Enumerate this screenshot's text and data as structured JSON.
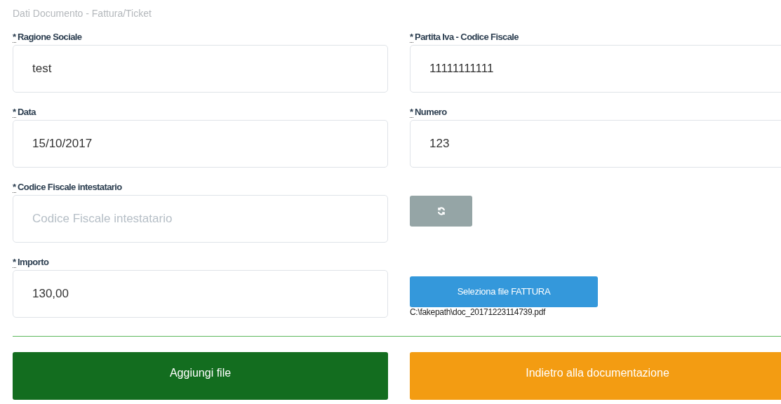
{
  "section_title": "Dati Documento - Fattura/Ticket",
  "fields": [
    {
      "label": "Ragione Sociale",
      "required_mark": "*",
      "value": "test"
    },
    {
      "label": "Partita Iva - Codice Fiscale",
      "required_mark": "*",
      "value": "11111111111"
    },
    {
      "label": "Data",
      "required_mark": "*",
      "value": "15/10/2017"
    },
    {
      "label": "Numero",
      "required_mark": "*",
      "value": "123"
    },
    {
      "label": "Codice Fiscale intestatario",
      "required_mark": "*",
      "placeholder": "Codice Fiscale intestatario"
    },
    {
      "kind": "refresh"
    },
    {
      "label": "Importo",
      "required_mark": "*",
      "value": "130,00"
    },
    {
      "kind": "file",
      "button": "Seleziona file FATTURA",
      "file_name": "C:\\fakepath\\doc_20171223114739.pdf"
    }
  ],
  "actions": [
    {
      "label": "Aggiungi file",
      "kind": "primary"
    },
    {
      "label": "Indietro alla documentazione",
      "kind": "back"
    }
  ]
}
